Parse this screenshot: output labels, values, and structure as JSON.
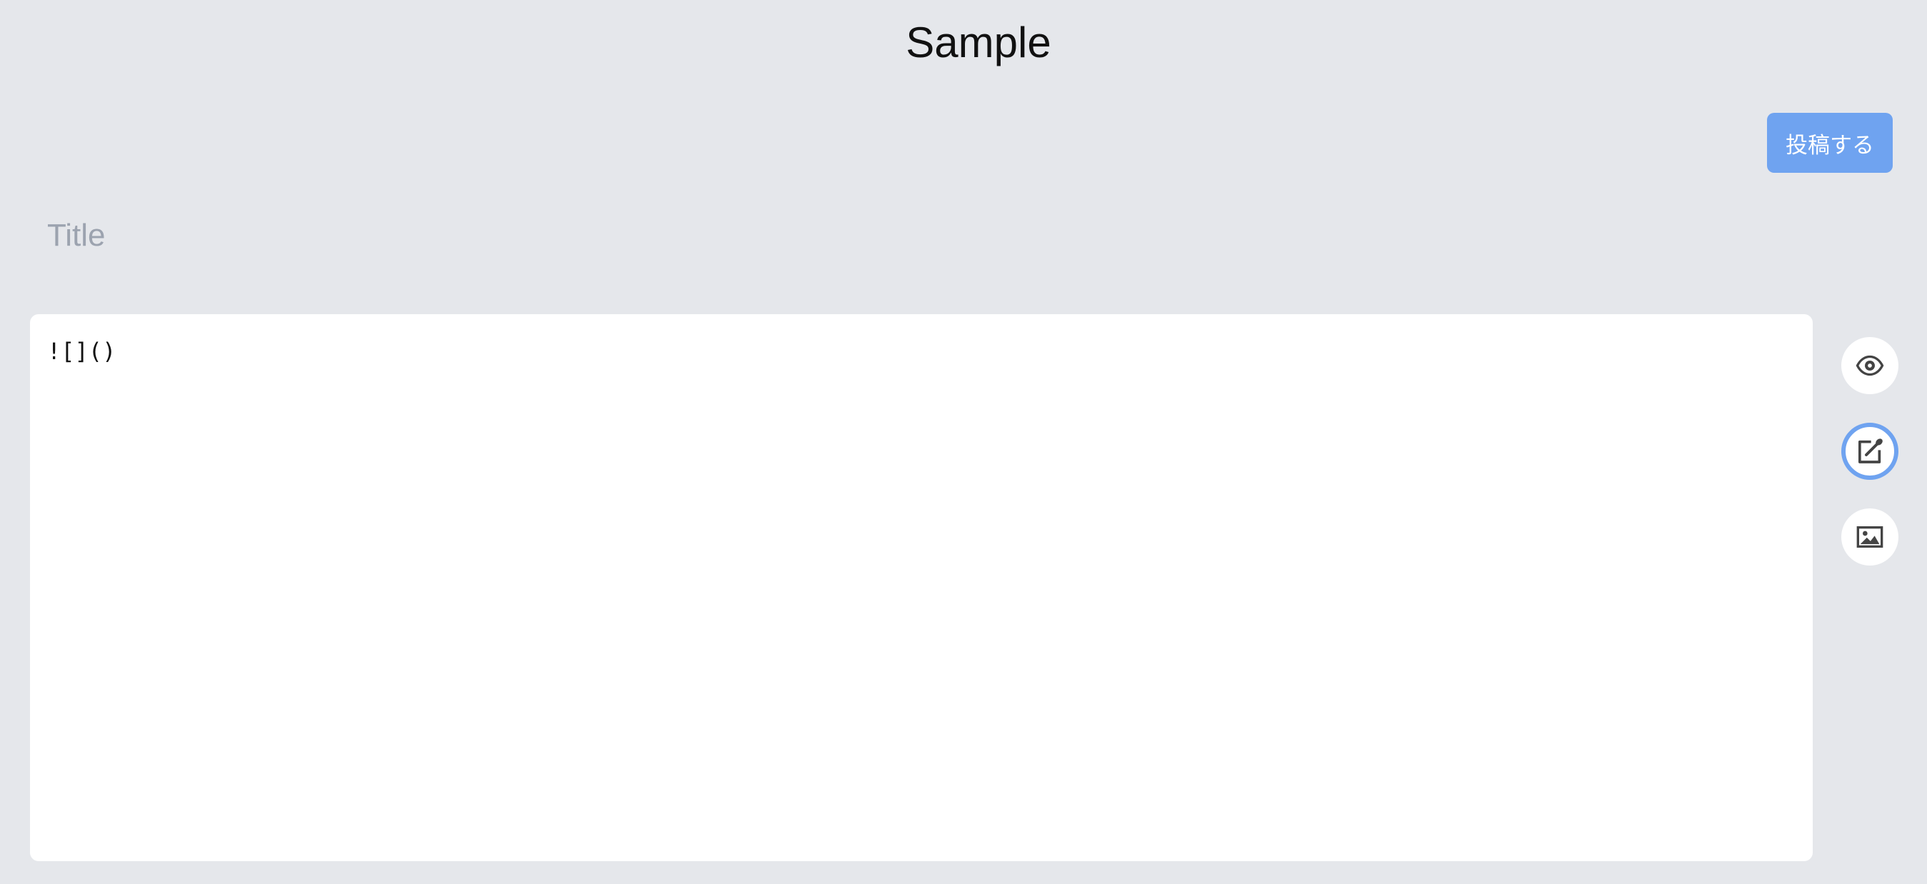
{
  "header": {
    "title": "Sample"
  },
  "toolbar": {
    "post_label": "投稿する"
  },
  "editor": {
    "title_placeholder": "Title",
    "title_value": "",
    "body_value": "![]()"
  },
  "side_tools": [
    {
      "icon": "eye-icon",
      "action": "preview",
      "active": false
    },
    {
      "icon": "edit-icon",
      "action": "edit",
      "active": true
    },
    {
      "icon": "image-icon",
      "action": "insert-image",
      "active": false
    }
  ],
  "colors": {
    "background": "#e5e7eb",
    "accent": "#6fa3f0",
    "panel": "#ffffff",
    "placeholder": "#9ca3af",
    "icon": "#444444"
  }
}
